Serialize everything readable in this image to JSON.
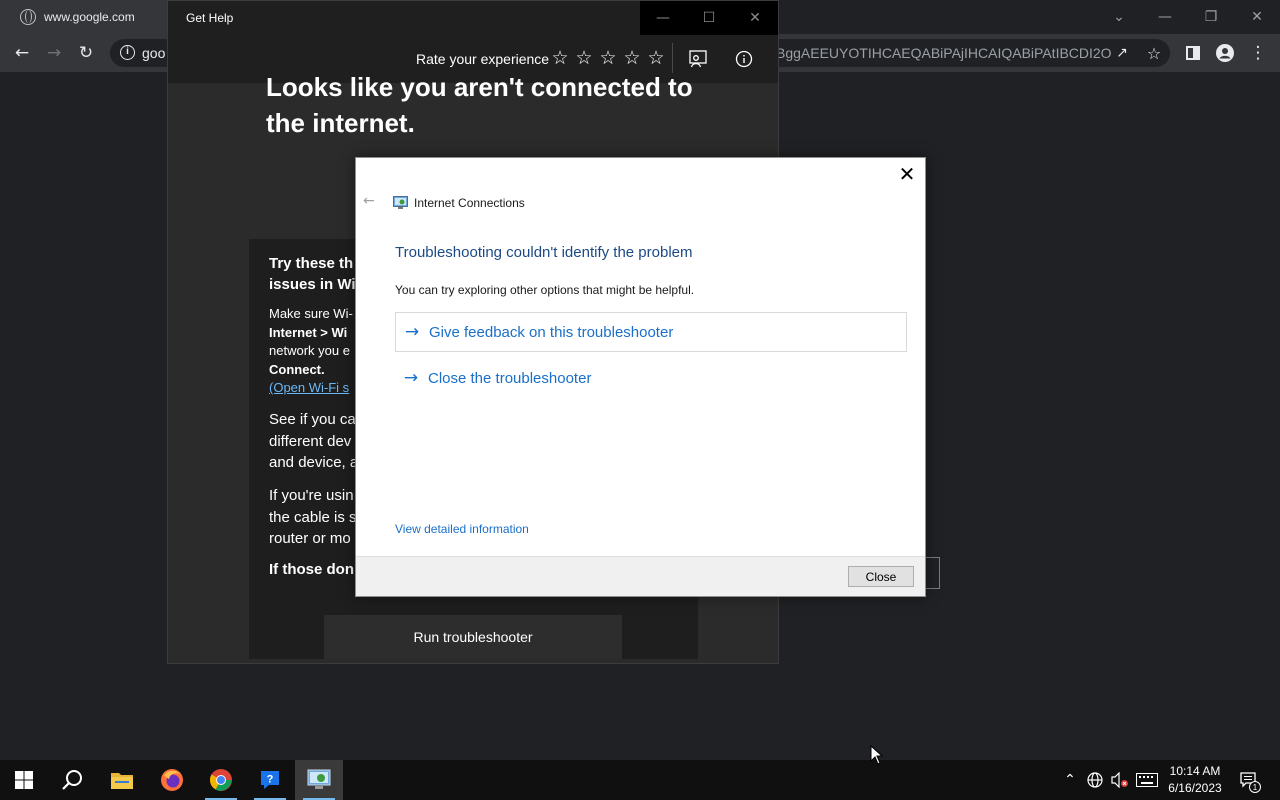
{
  "browser": {
    "tab_title": "www.google.com",
    "url_prefix": "goo",
    "url_tail": "BggAEEUYOTIHCAEQABiPAjIHCAIQABiPAtIBCDI2O..."
  },
  "get_help": {
    "window_title": "Get Help",
    "rate_label": "Rate your experience",
    "star_count": 5,
    "rating": 0,
    "heading": "Looks like you aren't connected to the internet.",
    "card": {
      "title": "Try these th… issues in Wi…",
      "title_line1": "Try these th",
      "title_line2": "issues in Wi",
      "step_line1": "Make sure Wi-",
      "step_line2": "Internet > Wi",
      "step_line3": "network you e",
      "step_line4": "Connect.",
      "link": "(Open Wi-Fi s",
      "para1_line1": "See if you ca",
      "para1_line2": "different dev",
      "para1_line3": "and device, a",
      "para2_line1": "If you're usin",
      "para2_line2": "the cable is s",
      "para2_line3": "router or mo",
      "strong": "If those don",
      "run_button": "Run troubleshooter"
    }
  },
  "dialog": {
    "app_title": "Internet Connections",
    "heading": "Troubleshooting couldn't identify the problem",
    "subtext": "You can try exploring other options that might be helpful.",
    "options": [
      {
        "label": "Give feedback on this troubleshooter"
      },
      {
        "label": "Close the troubleshooter"
      }
    ],
    "detail_link": "View detailed information",
    "close_button": "Close"
  },
  "taskbar": {
    "time": "10:14 AM",
    "date": "6/16/2023",
    "notification_count": "1"
  },
  "colors": {
    "dialog_heading": "#1c4a86",
    "link_blue": "#1a6fc9",
    "taskbar_active_underline": "#76b9ed"
  }
}
